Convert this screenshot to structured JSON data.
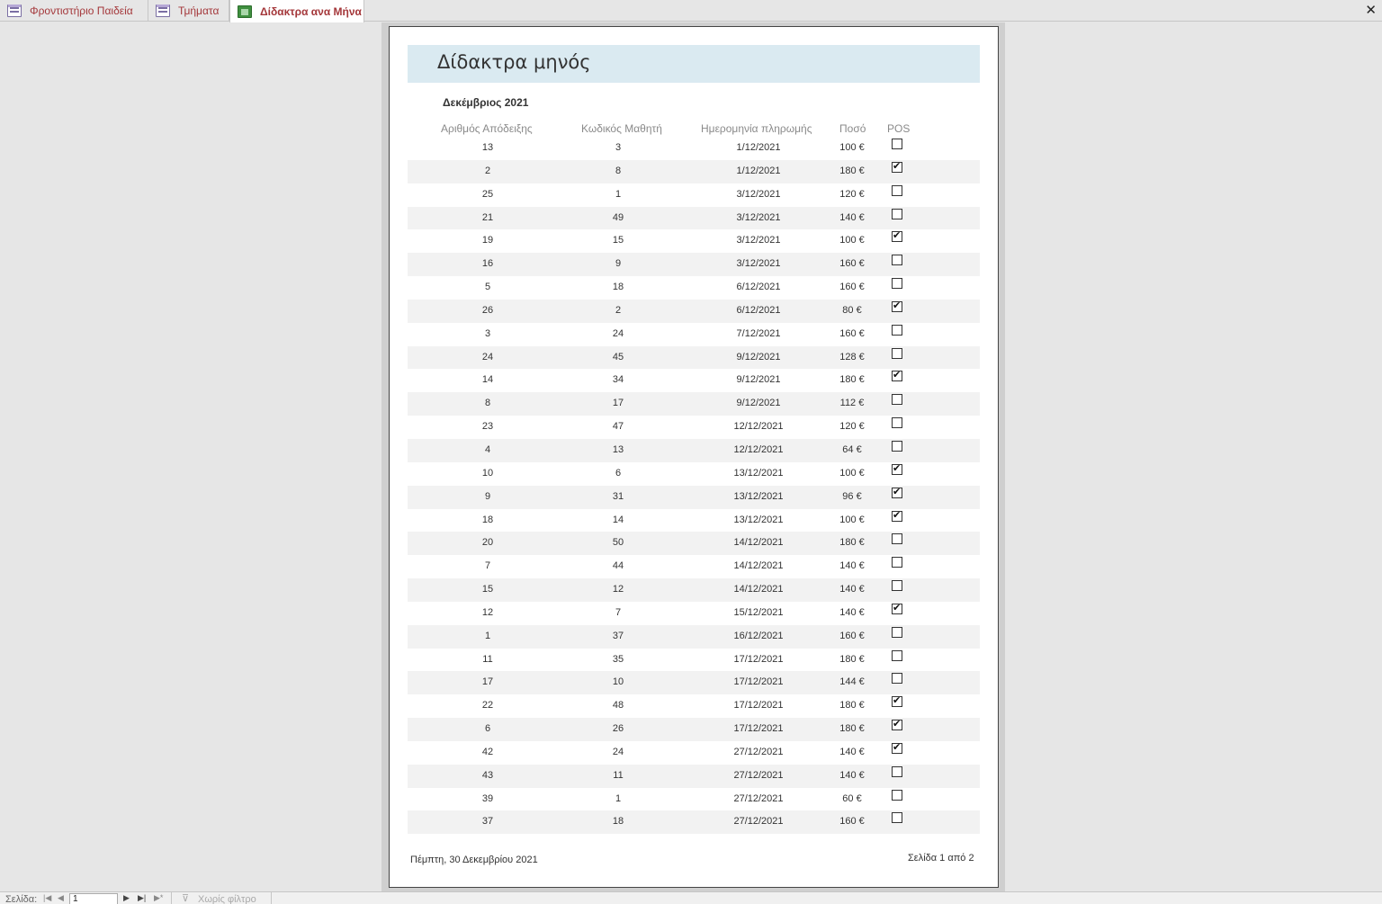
{
  "tabs": [
    {
      "label": "Φροντιστήριο Παιδεία",
      "icon": "form-icon"
    },
    {
      "label": "Τμήματα",
      "icon": "form-icon"
    },
    {
      "label": "Δίδακτρα ανα Μήνα",
      "icon": "report-icon"
    }
  ],
  "report": {
    "title": "Δίδακτρα μηνός",
    "group": "Δεκέμβριος 2021",
    "columns": {
      "receipt": "Αριθμός Απόδειξης",
      "student": "Κωδικός Μαθητή",
      "date": "Ημερομηνία πληρωμής",
      "amount": "Ποσό",
      "pos": "POS"
    },
    "rows": [
      {
        "receipt": "13",
        "student": "3",
        "date": "1/12/2021",
        "amount": "100 €",
        "pos": false
      },
      {
        "receipt": "2",
        "student": "8",
        "date": "1/12/2021",
        "amount": "180 €",
        "pos": true
      },
      {
        "receipt": "25",
        "student": "1",
        "date": "3/12/2021",
        "amount": "120 €",
        "pos": false
      },
      {
        "receipt": "21",
        "student": "49",
        "date": "3/12/2021",
        "amount": "140 €",
        "pos": false
      },
      {
        "receipt": "19",
        "student": "15",
        "date": "3/12/2021",
        "amount": "100 €",
        "pos": true
      },
      {
        "receipt": "16",
        "student": "9",
        "date": "3/12/2021",
        "amount": "160 €",
        "pos": false
      },
      {
        "receipt": "5",
        "student": "18",
        "date": "6/12/2021",
        "amount": "160 €",
        "pos": false
      },
      {
        "receipt": "26",
        "student": "2",
        "date": "6/12/2021",
        "amount": "80 €",
        "pos": true
      },
      {
        "receipt": "3",
        "student": "24",
        "date": "7/12/2021",
        "amount": "160 €",
        "pos": false
      },
      {
        "receipt": "24",
        "student": "45",
        "date": "9/12/2021",
        "amount": "128 €",
        "pos": false
      },
      {
        "receipt": "14",
        "student": "34",
        "date": "9/12/2021",
        "amount": "180 €",
        "pos": true
      },
      {
        "receipt": "8",
        "student": "17",
        "date": "9/12/2021",
        "amount": "112 €",
        "pos": false
      },
      {
        "receipt": "23",
        "student": "47",
        "date": "12/12/2021",
        "amount": "120 €",
        "pos": false
      },
      {
        "receipt": "4",
        "student": "13",
        "date": "12/12/2021",
        "amount": "64 €",
        "pos": false
      },
      {
        "receipt": "10",
        "student": "6",
        "date": "13/12/2021",
        "amount": "100 €",
        "pos": true
      },
      {
        "receipt": "9",
        "student": "31",
        "date": "13/12/2021",
        "amount": "96 €",
        "pos": true
      },
      {
        "receipt": "18",
        "student": "14",
        "date": "13/12/2021",
        "amount": "100 €",
        "pos": true
      },
      {
        "receipt": "20",
        "student": "50",
        "date": "14/12/2021",
        "amount": "180 €",
        "pos": false
      },
      {
        "receipt": "7",
        "student": "44",
        "date": "14/12/2021",
        "amount": "140 €",
        "pos": false
      },
      {
        "receipt": "15",
        "student": "12",
        "date": "14/12/2021",
        "amount": "140 €",
        "pos": false
      },
      {
        "receipt": "12",
        "student": "7",
        "date": "15/12/2021",
        "amount": "140 €",
        "pos": true
      },
      {
        "receipt": "1",
        "student": "37",
        "date": "16/12/2021",
        "amount": "160 €",
        "pos": false
      },
      {
        "receipt": "11",
        "student": "35",
        "date": "17/12/2021",
        "amount": "180 €",
        "pos": false
      },
      {
        "receipt": "17",
        "student": "10",
        "date": "17/12/2021",
        "amount": "144 €",
        "pos": false
      },
      {
        "receipt": "22",
        "student": "48",
        "date": "17/12/2021",
        "amount": "180 €",
        "pos": true
      },
      {
        "receipt": "6",
        "student": "26",
        "date": "17/12/2021",
        "amount": "180 €",
        "pos": true
      },
      {
        "receipt": "42",
        "student": "24",
        "date": "27/12/2021",
        "amount": "140 €",
        "pos": true
      },
      {
        "receipt": "43",
        "student": "11",
        "date": "27/12/2021",
        "amount": "140 €",
        "pos": false
      },
      {
        "receipt": "39",
        "student": "1",
        "date": "27/12/2021",
        "amount": "60 €",
        "pos": false
      },
      {
        "receipt": "37",
        "student": "18",
        "date": "27/12/2021",
        "amount": "160 €",
        "pos": false
      }
    ],
    "footer_date": "Πέμπτη, 30 Δεκεμβρίου 2021",
    "footer_page": "Σελίδα 1 από 2"
  },
  "navigation": {
    "page_label": "Σελίδα:",
    "page_value": "1",
    "filter_label": "Χωρίς φίλτρο"
  },
  "colors": {
    "tab_text": "#a4373a",
    "title_band": "#daeaf1",
    "alt_row": "#f2f2f2"
  }
}
